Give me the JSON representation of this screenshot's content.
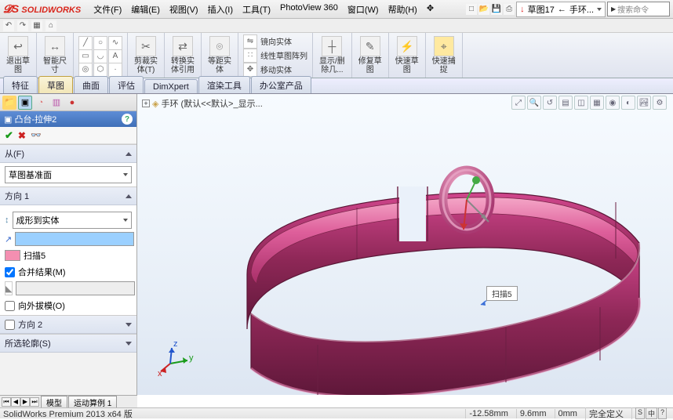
{
  "app": {
    "name": "SOLIDWORKS"
  },
  "menus": [
    "文件(F)",
    "编辑(E)",
    "视图(V)",
    "插入(I)",
    "工具(T)",
    "PhotoView 360",
    "窗口(W)",
    "帮助(H)"
  ],
  "title_dropdown": {
    "label": "草图17",
    "doc": "手环..."
  },
  "search_placeholder": "搜索命令",
  "ribbon": {
    "exit_sketch": "退出草\n图",
    "smart_dim": "智能尺\n寸",
    "trim": "剪裁实\n体(T)",
    "convert": "转换实\n体引用",
    "offset": "等距实\n体",
    "mirror": "镜向实体",
    "linear_pattern": "线性草图阵列",
    "move": "移动实体",
    "display_delete": "显示/删\n除几...",
    "repair": "修复草\n图",
    "rapid_sketch": "快速草\n图",
    "quick_snap": "快速捕\n捉"
  },
  "cm_tabs": [
    "特征",
    "草图",
    "曲面",
    "评估",
    "DimXpert",
    "渲染工具",
    "办公室产品"
  ],
  "cm_active": 1,
  "pm": {
    "title": "凸台-拉伸2",
    "from_head": "从(F)",
    "from_value": "草图基准面",
    "dir1_head": "方向 1",
    "end_cond": "成形到实体",
    "body_name": "扫描5",
    "merge": "合并结果(M)",
    "outward": "向外拔模(O)",
    "dir2_head": "方向 2",
    "contour_head": "所选轮廓(S)"
  },
  "tree_fly": "手环  (默认<<默认>_显示...",
  "annotation_label": "扫描5",
  "bottom_tabs": {
    "model": "模型",
    "motion": "运动算例 1"
  },
  "status": {
    "product": "SolidWorks Premium 2013 x64 版",
    "x": "-12.58mm",
    "y": "9.6mm",
    "z": "0mm",
    "def": "完全定义",
    "lang": [
      "S",
      "中",
      "?"
    ]
  },
  "colors": {
    "model_main": "#d8458e",
    "model_light": "#f090b8",
    "model_dark": "#9e2d62"
  }
}
